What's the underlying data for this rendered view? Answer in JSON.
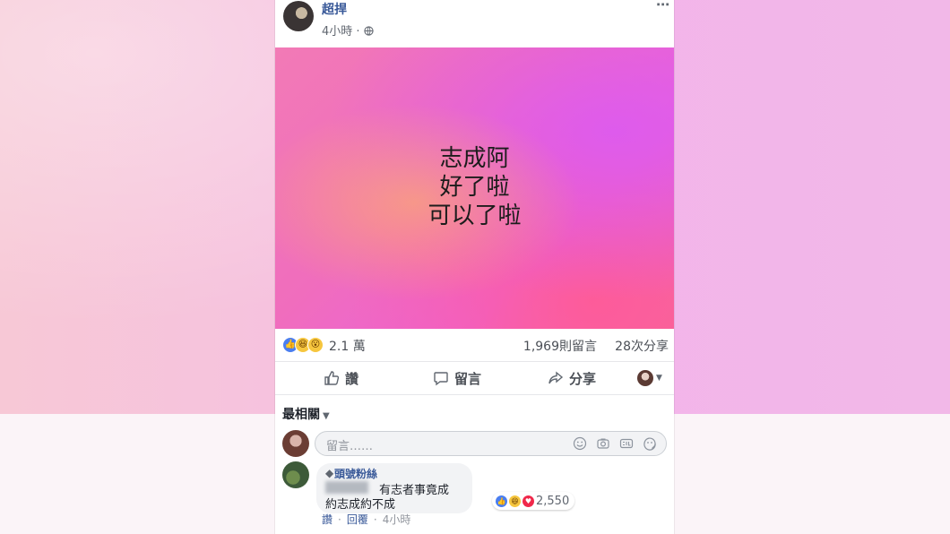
{
  "post": {
    "author": "超捍",
    "time": "4小時 · ",
    "more_icon": "⋯",
    "image_text": [
      "志成阿",
      "好了啦",
      "可以了啦"
    ],
    "reactions_count": "2.1 萬",
    "comments_count": "1,969則留言",
    "shares_count": "28次分享",
    "actions": {
      "like": "讚",
      "comment": "留言",
      "share": "分享"
    },
    "sort_label": "最相關",
    "composer_placeholder": "留言……"
  },
  "comment": {
    "author": "頭號粉絲",
    "line1": "有志者事竟成",
    "line2": "約志成約不成",
    "reactions": "2,550",
    "like": "讚",
    "reply": "回覆",
    "time": "4小時"
  },
  "colors": {
    "link": "#385898",
    "text": "#1d2129",
    "like": "#4a7ef0"
  }
}
